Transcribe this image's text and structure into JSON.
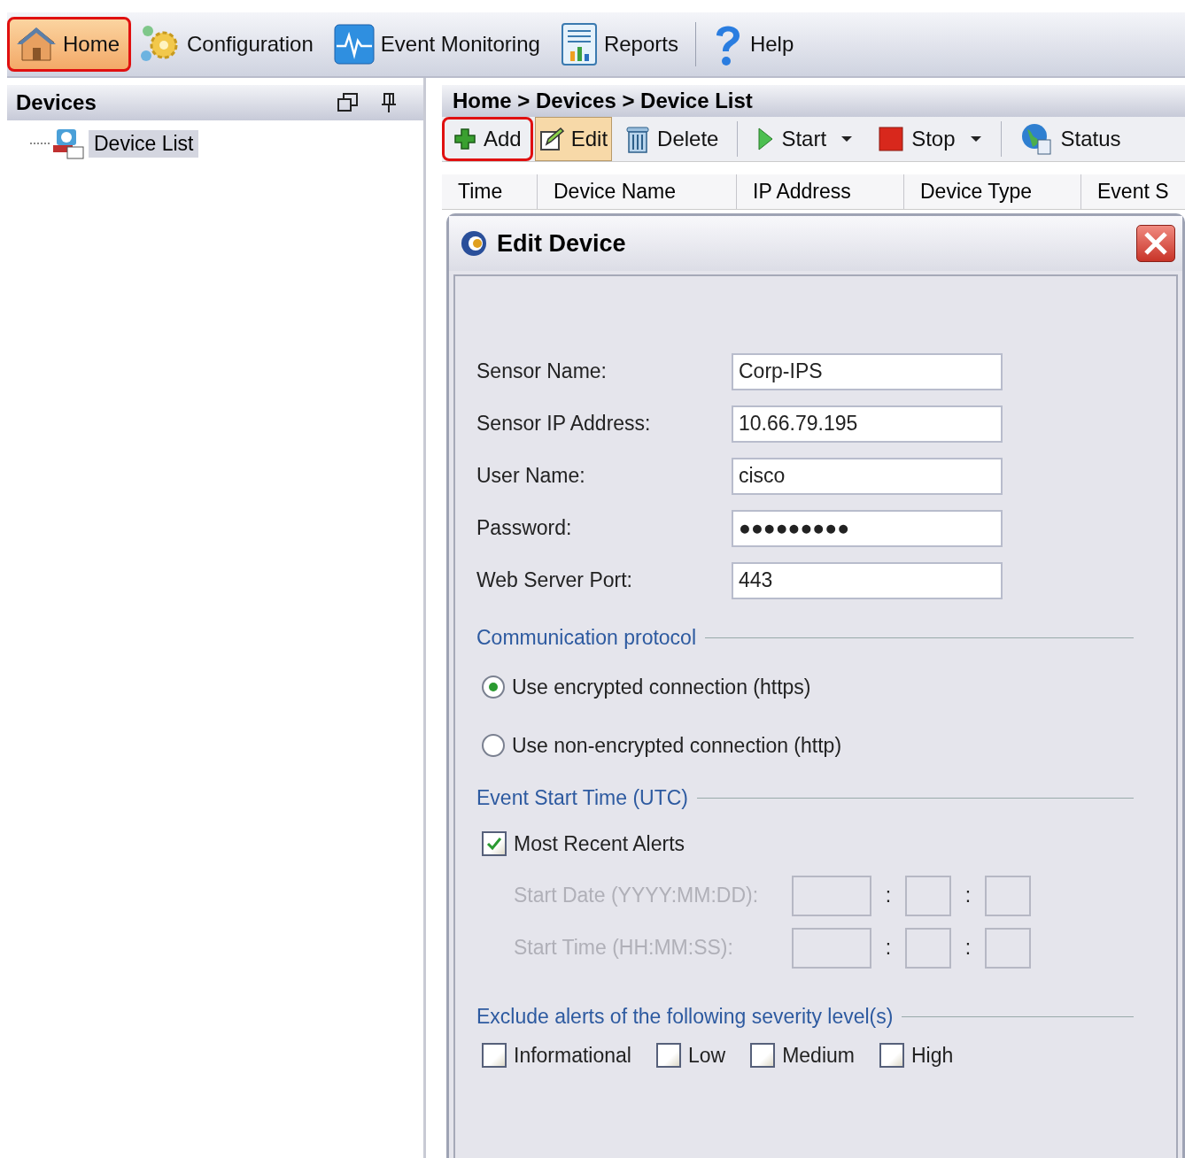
{
  "menu_bar": {
    "items": [
      {
        "label": "Home",
        "selected": true,
        "highlighted": true
      },
      {
        "label": "Configuration",
        "selected": false,
        "highlighted": false
      },
      {
        "label": "Event Monitoring",
        "selected": false,
        "highlighted": false
      },
      {
        "label": "Reports",
        "selected": false,
        "highlighted": false
      },
      {
        "label": "Help",
        "selected": false,
        "highlighted": false
      }
    ]
  },
  "sidebar": {
    "title": "Devices",
    "items": [
      {
        "label": "Device List",
        "selected": true
      }
    ]
  },
  "breadcrumb": "Home > Devices > Device List",
  "toolbar": [
    {
      "label": "Add",
      "highlighted": true,
      "selected": false,
      "dropdown": false
    },
    {
      "label": "Edit",
      "highlighted": false,
      "selected": true,
      "dropdown": false
    },
    {
      "label": "Delete",
      "highlighted": false,
      "selected": false,
      "dropdown": false
    },
    {
      "label": "Start",
      "highlighted": false,
      "selected": false,
      "dropdown": true
    },
    {
      "label": "Stop",
      "highlighted": false,
      "selected": false,
      "dropdown": true
    },
    {
      "label": "Status",
      "highlighted": false,
      "selected": false,
      "dropdown": false
    }
  ],
  "table": {
    "columns": [
      "Time",
      "Device Name",
      "IP Address",
      "Device Type",
      "Event S"
    ]
  },
  "dialog": {
    "title": "Edit Device",
    "fields": [
      {
        "label": "Sensor Name:",
        "value": "Corp-IPS"
      },
      {
        "label": "Sensor IP Address:",
        "value": "10.66.79.195"
      },
      {
        "label": "User Name:",
        "value": "cisco"
      },
      {
        "label": "Password:",
        "value": "●●●●●●●●●"
      },
      {
        "label": "Web Server Port:",
        "value": "443"
      }
    ],
    "protocol": {
      "title": "Communication protocol",
      "options": [
        {
          "label": "Use encrypted connection (https)",
          "selected": true
        },
        {
          "label": "Use non-encrypted connection (http)",
          "selected": false
        }
      ]
    },
    "start_time": {
      "title": "Event Start Time (UTC)",
      "most_recent": {
        "label": "Most Recent Alerts",
        "checked": true
      },
      "rows": [
        {
          "label": "Start Date (YYYY:MM:DD):",
          "disabled": true,
          "separators": [
            ":",
            ":"
          ]
        },
        {
          "label": "Start Time (HH:MM:SS):",
          "disabled": true,
          "separators": [
            ":",
            ":"
          ]
        }
      ]
    },
    "exclude": {
      "title": "Exclude alerts of the following severity level(s)",
      "levels": [
        {
          "label": "Informational",
          "checked": false
        },
        {
          "label": "Low",
          "checked": false
        },
        {
          "label": "Medium",
          "checked": false
        },
        {
          "label": "High",
          "checked": false
        }
      ]
    }
  }
}
